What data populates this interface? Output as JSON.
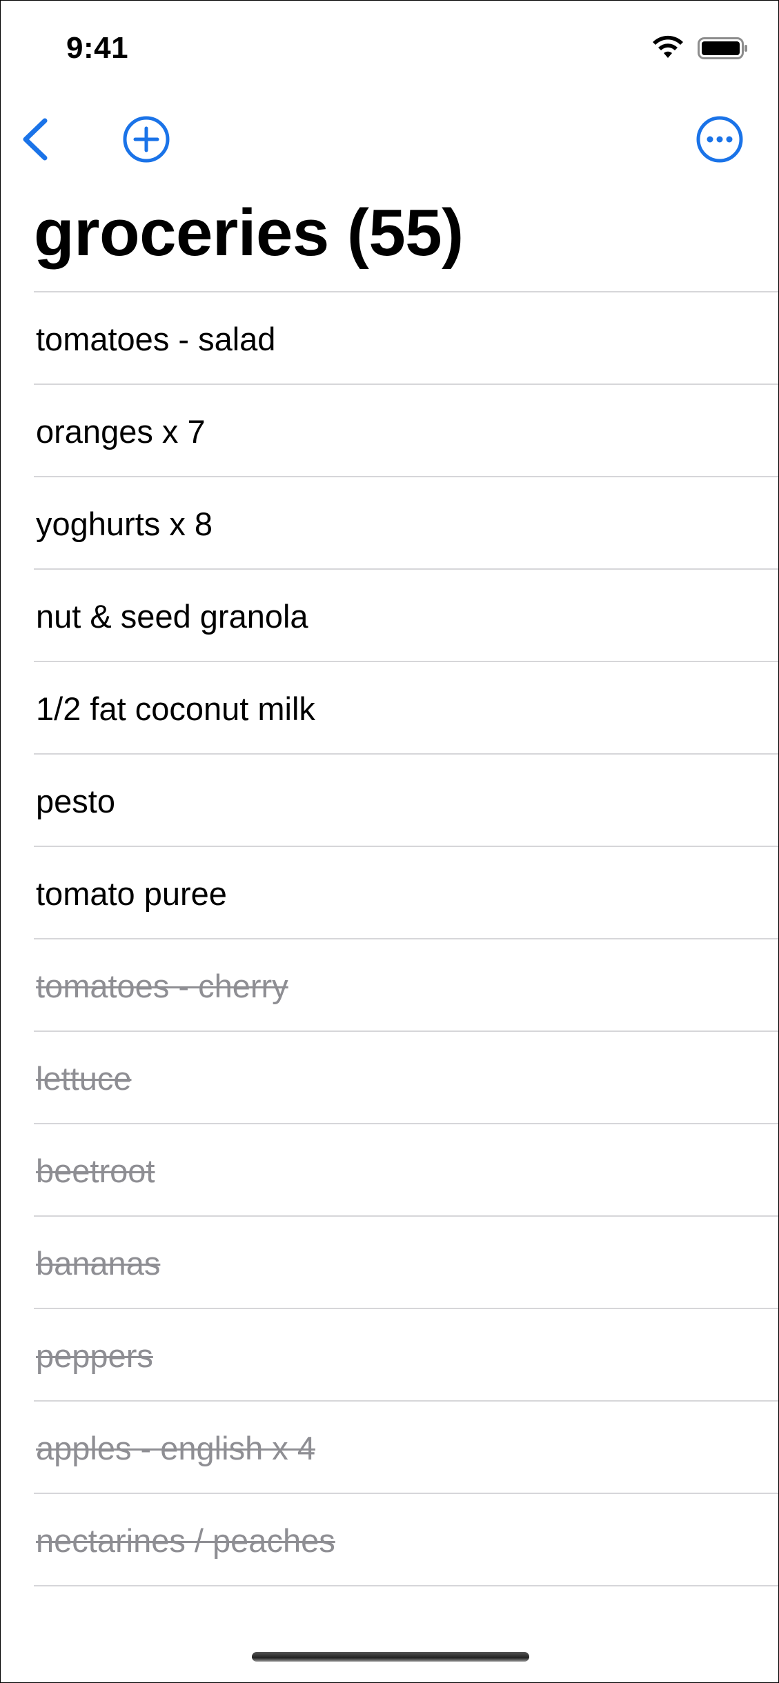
{
  "status_bar": {
    "time": "9:41"
  },
  "nav": {
    "back_icon": "chevron-left-icon",
    "add_icon": "plus-circle-icon",
    "more_icon": "ellipsis-circle-icon",
    "accent_color": "#1a73e8"
  },
  "title": "groceries (55)",
  "items": [
    {
      "label": "tomatoes - salad",
      "done": false
    },
    {
      "label": "oranges x 7",
      "done": false
    },
    {
      "label": "yoghurts x 8",
      "done": false
    },
    {
      "label": "nut & seed granola",
      "done": false
    },
    {
      "label": "1/2 fat coconut milk",
      "done": false
    },
    {
      "label": "pesto",
      "done": false
    },
    {
      "label": "tomato puree",
      "done": false
    },
    {
      "label": "tomatoes - cherry",
      "done": true
    },
    {
      "label": "lettuce",
      "done": true
    },
    {
      "label": "beetroot",
      "done": true
    },
    {
      "label": "bananas",
      "done": true
    },
    {
      "label": "peppers",
      "done": true
    },
    {
      "label": "apples - english x 4",
      "done": true
    },
    {
      "label": "nectarines / peaches",
      "done": true
    }
  ],
  "colors": {
    "done_text": "#8e8e93",
    "separator": "#d6d6d9"
  }
}
